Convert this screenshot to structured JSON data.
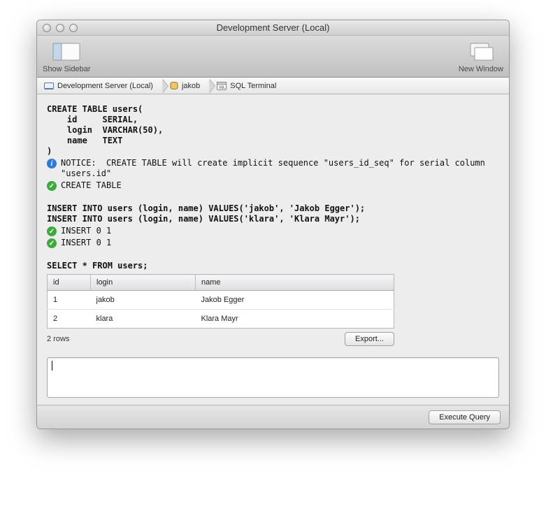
{
  "window": {
    "title": "Development Server (Local)"
  },
  "toolbar": {
    "left": {
      "label": "Show Sidebar"
    },
    "right": {
      "label": "New Window"
    }
  },
  "breadcrumb": {
    "items": [
      {
        "label": "Development Server (Local)"
      },
      {
        "label": "jakob"
      },
      {
        "label": "SQL Terminal"
      }
    ]
  },
  "sql": {
    "create_table": "CREATE TABLE users(\n    id     SERIAL,\n    login  VARCHAR(50),\n    name   TEXT\n)",
    "notice_label": "NOTICE:",
    "notice_text": "CREATE TABLE will create implicit sequence \"users_id_seq\" for serial column \"users.id\"",
    "create_result": "CREATE TABLE",
    "insert1": "INSERT INTO users (login, name) VALUES('jakob', 'Jakob Egger');",
    "insert2": "INSERT INTO users (login, name) VALUES('klara', 'Klara Mayr');",
    "insert_result1": "INSERT 0 1",
    "insert_result2": "INSERT 0 1",
    "select": "SELECT * FROM users;"
  },
  "table": {
    "columns": [
      "id",
      "login",
      "name"
    ],
    "rows": [
      {
        "id": "1",
        "login": "jakob",
        "name": "Jakob Egger"
      },
      {
        "id": "2",
        "login": "klara",
        "name": "Klara Mayr"
      }
    ],
    "row_count_label": "2 rows",
    "export_label": "Export..."
  },
  "query_input": {
    "value": ""
  },
  "buttons": {
    "execute": "Execute Query"
  }
}
